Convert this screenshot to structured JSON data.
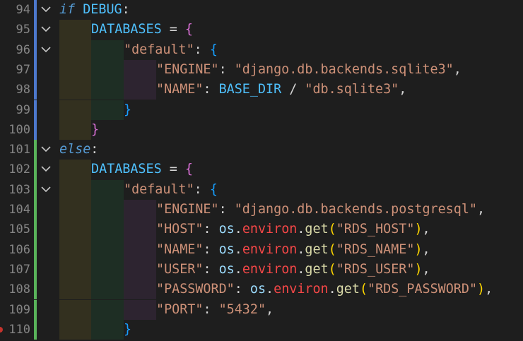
{
  "colors": {
    "background": "#1e1e1e",
    "gutter_modified": "#59b35a",
    "gutter_changed": "#4d78cc",
    "keyword": "#569cd6",
    "string": "#ce9178",
    "constant": "#4fc1ff"
  },
  "lines": [
    {
      "num": "94"
    },
    {
      "num": "95"
    },
    {
      "num": "96"
    },
    {
      "num": "97"
    },
    {
      "num": "98"
    },
    {
      "num": "99"
    },
    {
      "num": "100"
    },
    {
      "num": "101"
    },
    {
      "num": "102"
    },
    {
      "num": "103"
    },
    {
      "num": "104"
    },
    {
      "num": "105"
    },
    {
      "num": "106"
    },
    {
      "num": "107"
    },
    {
      "num": "108"
    },
    {
      "num": "109"
    },
    {
      "num": "110"
    }
  ],
  "code": {
    "if_kw": "if",
    "debug": "DEBUG",
    "colon": ":",
    "databases": "DATABASES",
    "eq": " = ",
    "lbrace": "{",
    "rbrace": "}",
    "default_key": "\"default\"",
    "key_colon": ": ",
    "engine_key": "\"ENGINE\"",
    "engine_sqlite": "\"django.db.backends.sqlite3\"",
    "comma": ",",
    "name_key": "\"NAME\"",
    "base_dir": "BASE_DIR",
    "slash": " / ",
    "db_file": "\"db.sqlite3\"",
    "else_kw": "else",
    "engine_pg": "\"django.db.backends.postgresql\"",
    "host_key": "\"HOST\"",
    "os": "os",
    "dot": ".",
    "environ": "environ",
    "get": "get",
    "lparen": "(",
    "rparen": ")",
    "rds_host": "\"RDS_HOST\"",
    "rds_name": "\"RDS_NAME\"",
    "user_key": "\"USER\"",
    "rds_user": "\"RDS_USER\"",
    "password_key": "\"PASSWORD\"",
    "rds_password": "\"RDS_PASSWORD\"",
    "port_key": "\"PORT\"",
    "port_val": "\"5432\""
  }
}
